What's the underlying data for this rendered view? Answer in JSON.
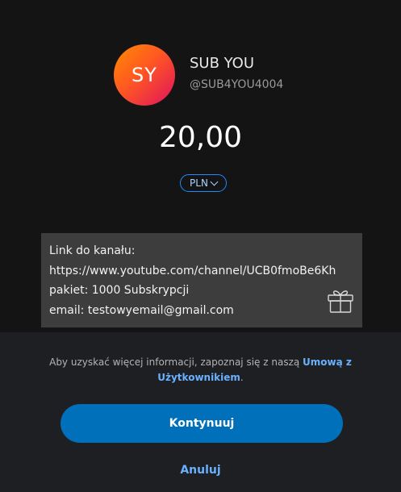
{
  "recipient": {
    "initials": "SY",
    "name": "SUB YOU",
    "handle": "@SUB4YOU4004"
  },
  "payment": {
    "amount": "20,00",
    "currency": "PLN"
  },
  "note": {
    "lines": [
      "Link do kanału:",
      "https://www.youtube.com/channel/UCB0fmoBe6Kh",
      "pakiet: 1000 Subskrypcji",
      "email: testowyemail@gmail.com"
    ]
  },
  "footer": {
    "terms_prefix": "Aby uzyskać więcej informacji, zapoznaj się z naszą ",
    "terms_link": "Umową z Użytkownikiem",
    "terms_suffix": ".",
    "continue_label": "Kontynuuj",
    "cancel_label": "Anuluj"
  },
  "colors": {
    "accent": "#0070ba",
    "link": "#69b1ff",
    "background": "#141414"
  },
  "icons": [
    "gift-icon",
    "chevron-down-icon"
  ]
}
